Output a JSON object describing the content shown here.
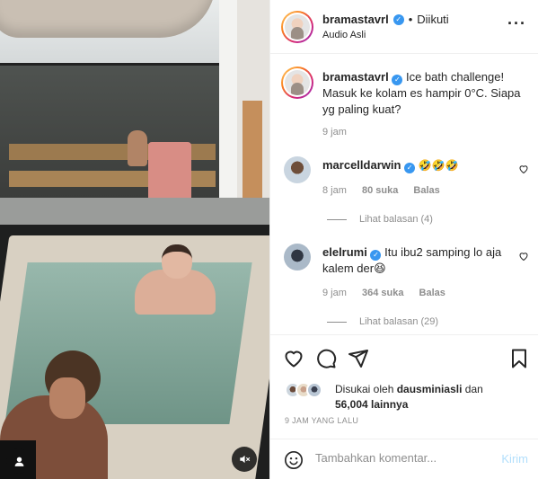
{
  "post": {
    "author": "bramastavrl",
    "follow_status": "Diikuti",
    "separator": "•",
    "audio": "Audio Asli",
    "more_icon": "more-horizontal-icon",
    "caption_text": "Ice bath challenge! Masuk ke kolam es hampir 0°C. Siapa yg paling kuat?",
    "caption_time": "9 jam"
  },
  "comments": [
    {
      "username": "marcelldarwin",
      "text": "🤣🤣🤣",
      "time": "8 jam",
      "likes": "80 suka",
      "reply": "Balas",
      "view_replies": "Lihat balasan (4)"
    },
    {
      "username": "elelrumi",
      "text": "Itu ibu2 samping lo aja kalem der😆",
      "time": "9 jam",
      "likes": "364 suka",
      "reply": "Balas",
      "view_replies": "Lihat balasan (29)"
    }
  ],
  "likes": {
    "prefix": "Disukai oleh",
    "user": "dausminiasli",
    "conjunction": "dan",
    "count": "56,004 lainnya"
  },
  "time_ago": "9 JAM YANG LALU",
  "comment_box": {
    "placeholder": "Tambahkan komentar...",
    "post_label": "Kirim"
  },
  "colors": {
    "verified": "#3897f0",
    "muted": "#8e8e8e",
    "post_button_disabled": "#b2dffc",
    "text": "#262626"
  }
}
